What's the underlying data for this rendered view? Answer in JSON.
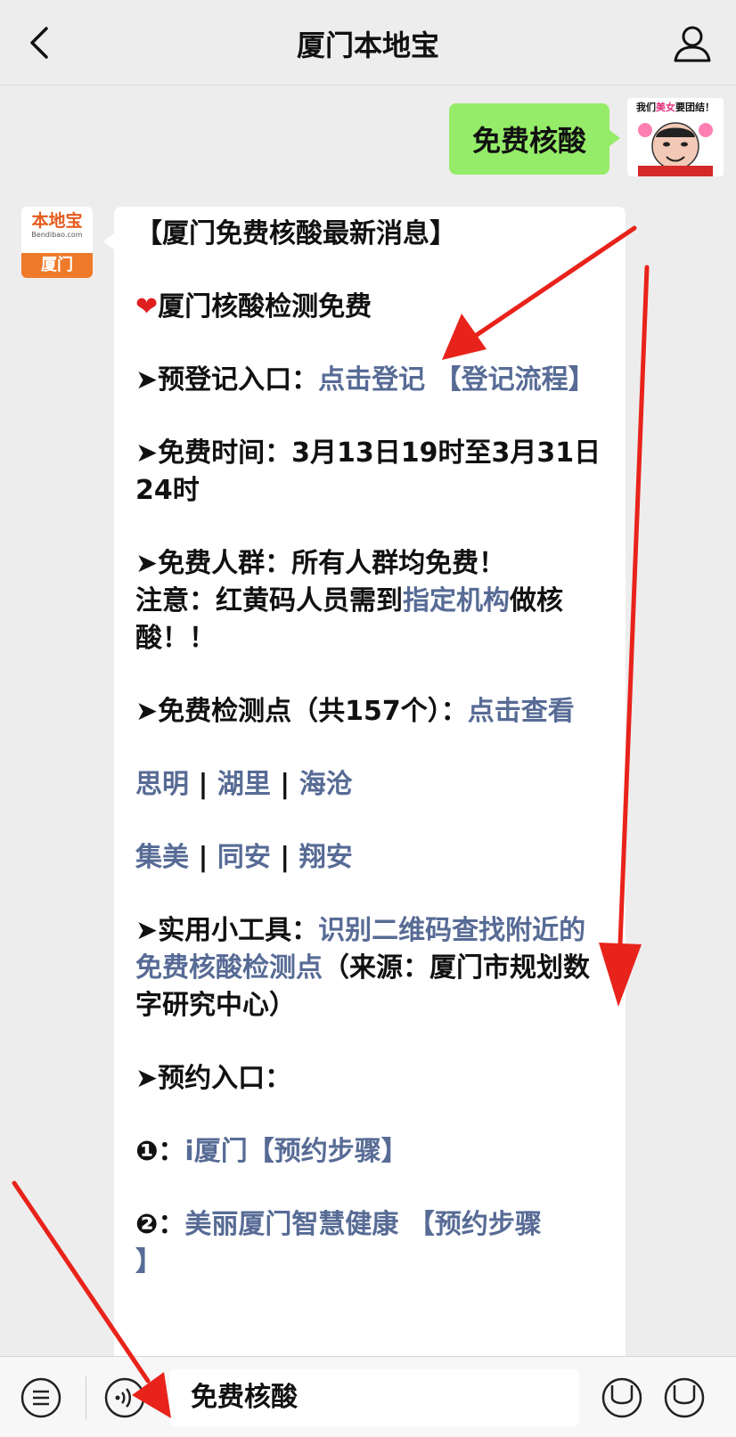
{
  "header": {
    "title": "厦门本地宝"
  },
  "sent_message": {
    "text": "免费核酸"
  },
  "user_avatar": {
    "meme_text_pre": "我们",
    "meme_text_highlight": "美女",
    "meme_text_post": "要团结！"
  },
  "bot_avatar": {
    "logo_name": "本地宝",
    "logo_site": "Bendibao.com",
    "city": "厦门"
  },
  "reply": {
    "title": "【厦门免费核酸最新消息】",
    "heart_line": "厦门核酸检测免费",
    "prereg_label": "➤预登记入口：",
    "prereg_link": "点击登记",
    "prereg_flow_link": "【登记流程】",
    "time_line": "➤免费时间：3月13日19时至3月31日24时",
    "crowd_line": "➤免费人群：所有人群均免费！",
    "notice_pre": "注意：红黄码人员需到",
    "notice_link": "指定机构",
    "notice_post": "做核酸！！",
    "points_label": "➤免费检测点（共157个）：",
    "points_link": "点击查看",
    "districts_row1": [
      "思明",
      "湖里",
      "海沧"
    ],
    "districts_row2": [
      "集美",
      "同安",
      "翔安"
    ],
    "divider": " | ",
    "tool_label": "➤实用小工具：",
    "tool_link": "识别二维码查找附近的免费核酸检测点",
    "tool_source": "（来源：厦门市规划数字研究中心）",
    "booking_label": "➤预约入口：",
    "option1_num": "❶：",
    "option1_link": "i厦门",
    "option1_steps": "【预约步骤】",
    "option2_num": "❷：",
    "option2_link": "美丽厦门智慧健康",
    "option2_steps": "【预约步骤",
    "option2_steps_tail": "】"
  },
  "input_bar": {
    "value": "免费核酸"
  },
  "colors": {
    "link": "#576b95",
    "sent_bubble": "#95ec69",
    "arrow": "#e8231b",
    "background": "#ededed"
  }
}
